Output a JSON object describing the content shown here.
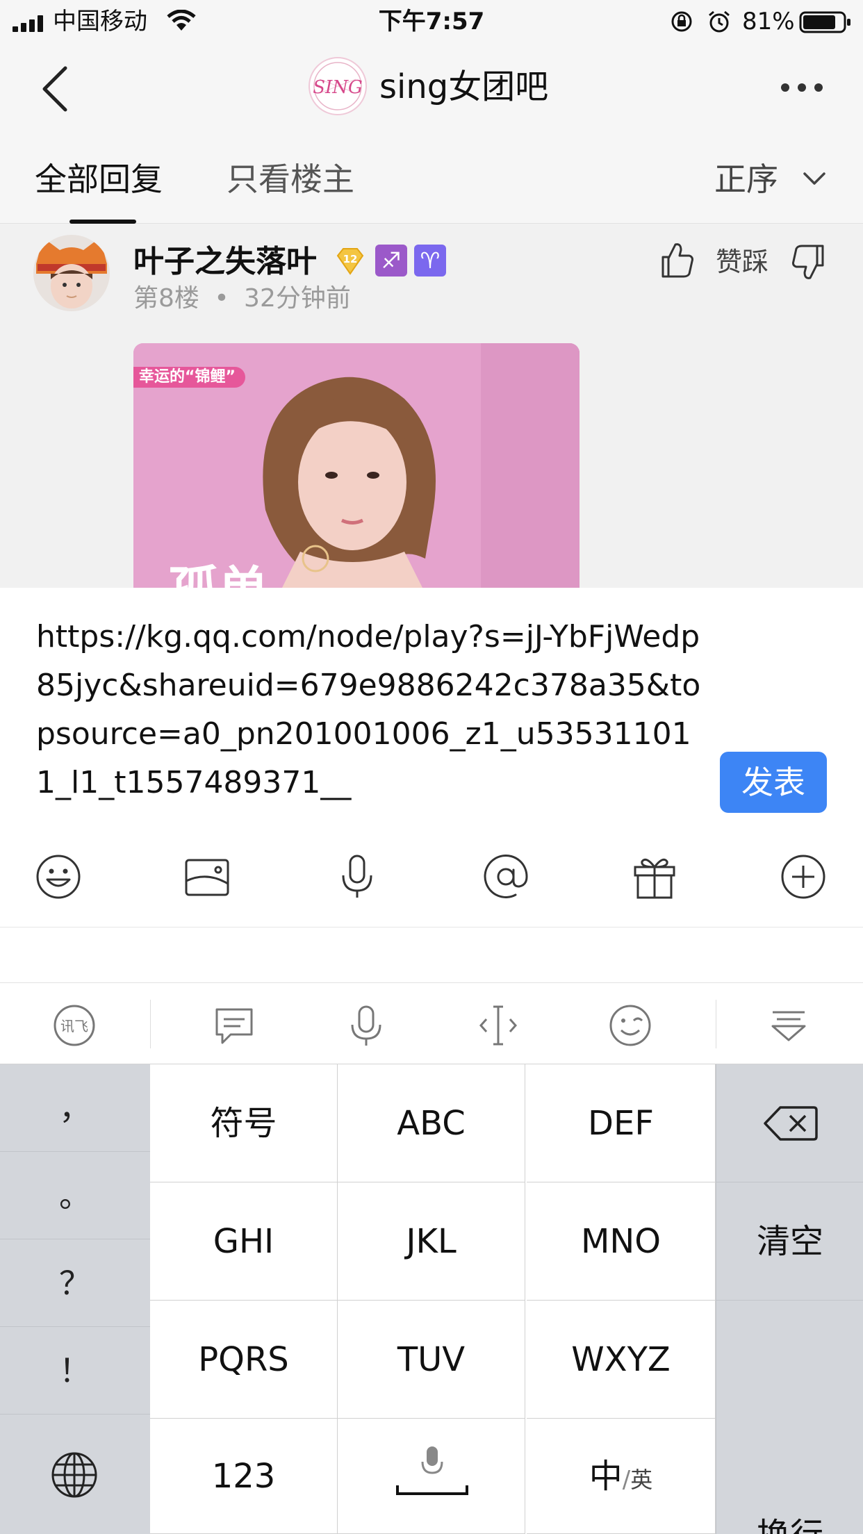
{
  "status_bar": {
    "carrier": "中国移动",
    "time": "下午7:57",
    "battery": "81%"
  },
  "nav": {
    "title": "sing女团吧",
    "logo_text": "SING"
  },
  "tabs": {
    "all_replies": "全部回复",
    "op_only": "只看楼主",
    "sort": "正序"
  },
  "post": {
    "username": "叶子之失落叶",
    "level": "12",
    "badges": [
      "♐",
      "♈"
    ],
    "floor": "第8楼",
    "dot": "•",
    "time": "32分钟前",
    "vote_label": "赞踩",
    "photo_tag": "幸运的“锦鲤”",
    "photo_caption": "孤单"
  },
  "composer": {
    "text": "https://kg.qq.com/node/play?s=jJ-YbFjWedp85jyc&shareuid=679e9886242c378a35&topsource=a0_pn201001006_z1_u535311011_l1_t1557489371__",
    "send": "发表"
  },
  "keyboard": {
    "toolbar_logo": "讯飞",
    "left_keys": [
      "，",
      "。",
      "？",
      "！"
    ],
    "keys": [
      [
        "符号",
        "ABC",
        "DEF"
      ],
      [
        "GHI",
        "JKL",
        "MNO"
      ],
      [
        "PQRS",
        "TUV",
        "WXYZ"
      ],
      [
        "123",
        "",
        "中"
      ]
    ],
    "lang_sub": "英",
    "clear": "清空",
    "newline": "换行"
  },
  "colors": {
    "accent": "#3d85f5",
    "kb_side": "#d3d6db",
    "badge_purple": "#9b59c9",
    "badge_violet": "#7b68ee",
    "level_gold": "#f4c542"
  }
}
